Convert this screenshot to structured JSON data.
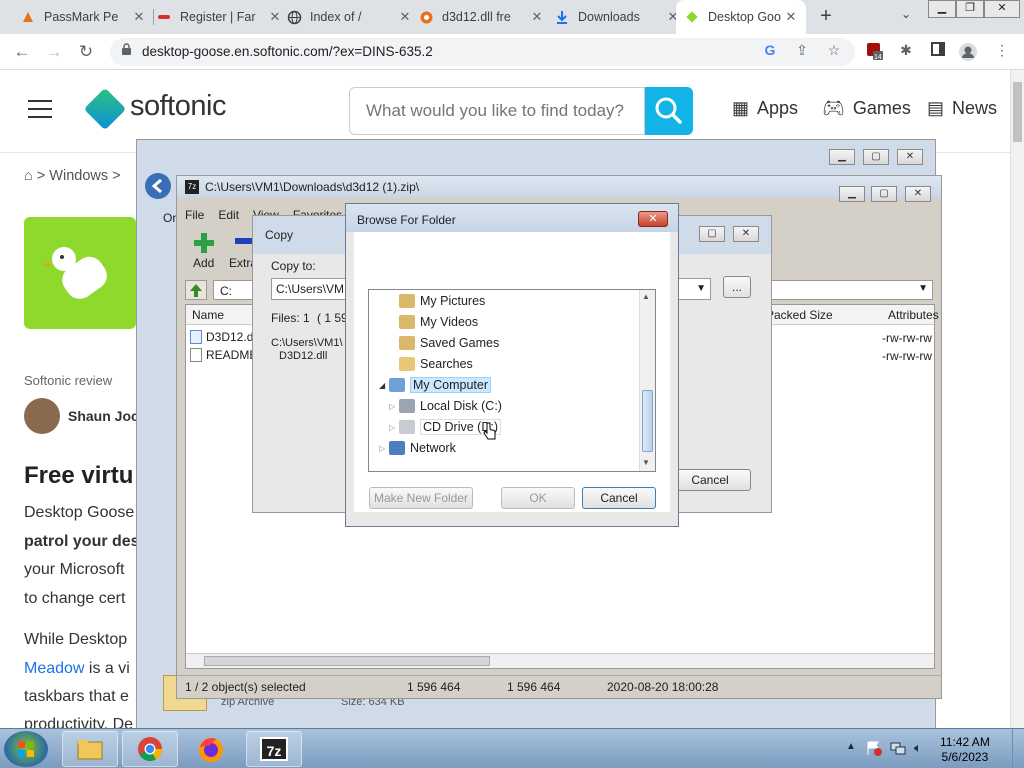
{
  "browser": {
    "tabs": [
      {
        "title": "PassMark Pe",
        "icon": "passmark-icon"
      },
      {
        "title": "Register | Far",
        "icon": "register-icon"
      },
      {
        "title": "Index of /",
        "icon": "globe-icon"
      },
      {
        "title": "d3d12.dll fre",
        "icon": "gear-icon"
      },
      {
        "title": "Downloads",
        "icon": "download-icon"
      },
      {
        "title": "Desktop Goo",
        "icon": "softonic-icon"
      }
    ],
    "url": "desktop-goose.en.softonic.com/?ex=DINS-635.2",
    "extension_badge": "14"
  },
  "page": {
    "brand": "softonic",
    "search_placeholder": "What would you like to find today?",
    "nav": [
      {
        "label": "Apps",
        "icon": "apps-grid-icon"
      },
      {
        "label": "Games",
        "icon": "gamepad-icon"
      },
      {
        "label": "News",
        "icon": "news-icon"
      }
    ],
    "breadcrumb": "> Windows >",
    "review_label": "Softonic review",
    "author": "Shaun Joc",
    "heading": "Free virtu",
    "para1": [
      "Desktop Goose",
      "patrol your des",
      "your Microsoft",
      "to change cert"
    ],
    "para2": [
      "While Desktop",
      "Meadow",
      " is a vi",
      "taskbars that e",
      "productivity. De"
    ]
  },
  "sevenzip": {
    "title": "C:\\Users\\VM1\\Downloads\\d3d12 (1).zip\\",
    "menu": [
      "File",
      "Edit",
      "View",
      "Favorites"
    ],
    "toolbar": [
      {
        "label": "Add"
      },
      {
        "label": "Extra"
      }
    ],
    "path": "C:",
    "columns": {
      "name": "Name",
      "packed": "Packed Size",
      "attributes": "Attributes"
    },
    "files": [
      {
        "name": "D3D12.dl",
        "attrs": "-rw-rw-rw"
      },
      {
        "name": "README",
        "attrs": "-rw-rw-rw"
      }
    ],
    "status": [
      "1 / 2 object(s) selected",
      "1 596 464",
      "1 596 464",
      "2020-08-20 18:00:28"
    ],
    "partial_left": "Or",
    "partial_tile_text": "zip Archive",
    "partial_tile_size": "Size: 634 KB"
  },
  "copy_dialog": {
    "title": "Copy",
    "copy_to_label": "Copy to:",
    "copy_to_value": "C:\\Users\\VM1\\",
    "files_label": "Files: 1",
    "files_extra": "( 1 59",
    "src_path": "C:\\Users\\VM1\\",
    "src_file": "D3D12.dll",
    "browse_label": "...",
    "cancel_label": "Cancel"
  },
  "browse_dialog": {
    "title": "Browse For Folder",
    "tree": [
      {
        "label": "My Pictures",
        "level": 2
      },
      {
        "label": "My Videos",
        "level": 2
      },
      {
        "label": "Saved Games",
        "level": 2
      },
      {
        "label": "Searches",
        "level": 2
      },
      {
        "label": "My Computer",
        "level": 1,
        "selected": true,
        "expanded": true
      },
      {
        "label": "Local Disk (C:)",
        "level": 2
      },
      {
        "label": "CD Drive (D:)",
        "level": 2
      },
      {
        "label": "Network",
        "level": 1
      }
    ],
    "make_folder_label": "Make New Folder",
    "ok_label": "OK",
    "cancel_label": "Cancel"
  },
  "taskbar": {
    "time": "11:42 AM",
    "date": "5/6/2023",
    "apps": [
      "explorer-icon",
      "chrome-icon",
      "firefox-icon",
      "7zip-icon"
    ],
    "sevenzip_label": "7z"
  }
}
